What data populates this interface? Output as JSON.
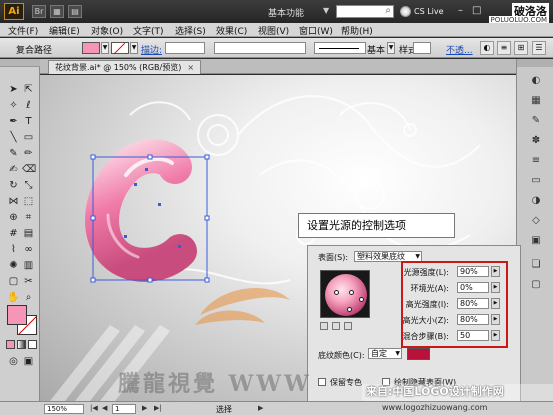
{
  "app": {
    "logo": "Ai",
    "workspace": "基本功能",
    "cslive": "CS Live",
    "window_buttons": [
      "–",
      "□",
      "✕"
    ],
    "corner_logo": "破洛洛",
    "corner_url": "POLUOLUO.COM"
  },
  "menu": [
    "文件(F)",
    "编辑(E)",
    "对象(O)",
    "文字(T)",
    "选择(S)",
    "效果(C)",
    "视图(V)",
    "窗口(W)",
    "帮助(H)"
  ],
  "controlbar": {
    "selection_label": "复合路径",
    "fill_color": "#f595b8",
    "stroke_label": "描边:",
    "brush_label": "基本",
    "style_label": "样式:",
    "opacity_link": "不透..."
  },
  "document_tab": {
    "title": "花纹背景.ai* @ 150% (RGB/预览)",
    "close": "×"
  },
  "callout_text": "设置光源的控制选项",
  "panel": {
    "surface_label": "表面(S):",
    "surface_value": "塑料效果底纹",
    "options": [
      {
        "label": "光源强度(L):",
        "value": "90%"
      },
      {
        "label": "环境光(A):",
        "value": "0%"
      },
      {
        "label": "高光强度(I):",
        "value": "80%"
      },
      {
        "label": "高光大小(Z):",
        "value": "80%"
      },
      {
        "label": "混合步骤(B):",
        "value": "50"
      }
    ],
    "shading_label": "底纹颜色(C):",
    "shading_value": "自定",
    "shading_color": "#b8123a",
    "preserve_spot_label": "保留专色",
    "hidden_faces_label": "绘制隐藏表面(W)"
  },
  "status": {
    "zoom": "150%",
    "page": "1",
    "tool": "选择"
  },
  "watermarks": {
    "big": "騰龍視覺 WWW",
    "banner": "来自:中国LOGO设计制作网",
    "url": "www.logozhizuowang.com"
  },
  "colors": {
    "accent_red": "#c81818",
    "letter_pink": "#f07aa8",
    "selection_blue": "#3b5bdb"
  }
}
